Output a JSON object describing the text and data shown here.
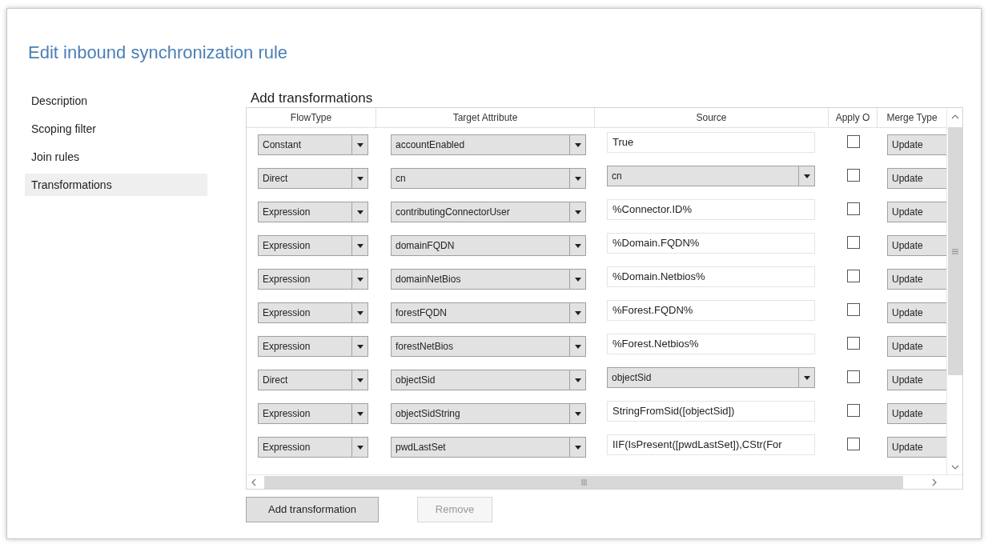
{
  "title": "Edit inbound synchronization rule",
  "sidebar": {
    "items": [
      {
        "label": "Description",
        "selected": false
      },
      {
        "label": "Scoping filter",
        "selected": false
      },
      {
        "label": "Join rules",
        "selected": false
      },
      {
        "label": "Transformations",
        "selected": true
      }
    ]
  },
  "section_title": "Add transformations",
  "table": {
    "columns": [
      "FlowType",
      "Target Attribute",
      "Source",
      "Apply O",
      "Merge Type"
    ],
    "rows": [
      {
        "flow_type": "Constant",
        "target": "accountEnabled",
        "source": {
          "kind": "text",
          "value": "True"
        },
        "apply_once": false,
        "merge_type": "Update"
      },
      {
        "flow_type": "Direct",
        "target": "cn",
        "source": {
          "kind": "dropdown",
          "value": "cn"
        },
        "apply_once": false,
        "merge_type": "Update"
      },
      {
        "flow_type": "Expression",
        "target": "contributingConnectorUser",
        "source": {
          "kind": "text",
          "value": "%Connector.ID%"
        },
        "apply_once": false,
        "merge_type": "Update"
      },
      {
        "flow_type": "Expression",
        "target": "domainFQDN",
        "source": {
          "kind": "text",
          "value": "%Domain.FQDN%"
        },
        "apply_once": false,
        "merge_type": "Update"
      },
      {
        "flow_type": "Expression",
        "target": "domainNetBios",
        "source": {
          "kind": "text",
          "value": "%Domain.Netbios%"
        },
        "apply_once": false,
        "merge_type": "Update"
      },
      {
        "flow_type": "Expression",
        "target": "forestFQDN",
        "source": {
          "kind": "text",
          "value": "%Forest.FQDN%"
        },
        "apply_once": false,
        "merge_type": "Update"
      },
      {
        "flow_type": "Expression",
        "target": "forestNetBios",
        "source": {
          "kind": "text",
          "value": "%Forest.Netbios%"
        },
        "apply_once": false,
        "merge_type": "Update"
      },
      {
        "flow_type": "Direct",
        "target": "objectSid",
        "source": {
          "kind": "dropdown",
          "value": "objectSid"
        },
        "apply_once": false,
        "merge_type": "Update"
      },
      {
        "flow_type": "Expression",
        "target": "objectSidString",
        "source": {
          "kind": "text",
          "value": "StringFromSid([objectSid])"
        },
        "apply_once": false,
        "merge_type": "Update"
      },
      {
        "flow_type": "Expression",
        "target": "pwdLastSet",
        "source": {
          "kind": "text",
          "value": "IIF(IsPresent([pwdLastSet]),CStr(For"
        },
        "apply_once": false,
        "merge_type": "Update"
      }
    ]
  },
  "buttons": [
    {
      "label": "Add transformation",
      "disabled": false
    },
    {
      "label": "Remove",
      "disabled": true
    }
  ]
}
